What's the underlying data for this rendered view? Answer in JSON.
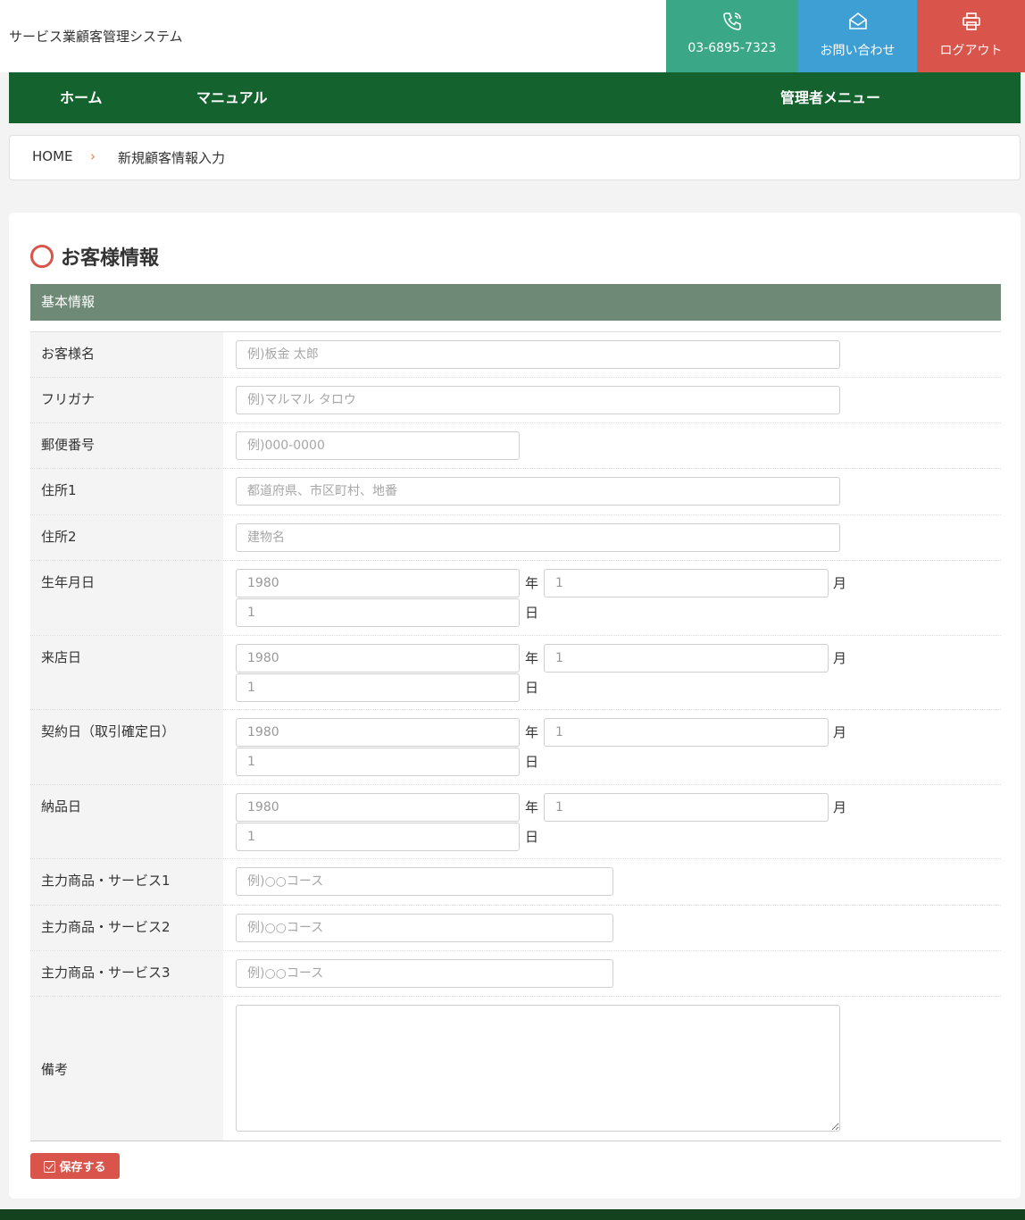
{
  "header": {
    "site_title": "サービス業顧客管理システム",
    "phone_label": "03-6895-7323",
    "contact_label": "お問い合わせ",
    "logout_label": "ログアウト",
    "colors": {
      "phone": "#3aa886",
      "contact": "#3d9fd3",
      "logout": "#d9544a"
    }
  },
  "nav": {
    "home": "ホーム",
    "manual": "マニュアル",
    "admin": "管理者メニュー"
  },
  "breadcrumb": {
    "home": "HOME",
    "separator": "›",
    "current": "新規顧客情報入力"
  },
  "section": {
    "title": "お客様情報",
    "subheading": "基本情報"
  },
  "form": {
    "name": {
      "label": "お客様名",
      "placeholder": "例)板金 太郎"
    },
    "kana": {
      "label": "フリガナ",
      "placeholder": "例)マルマル タロウ"
    },
    "zip": {
      "label": "郵便番号",
      "placeholder": "例)000-0000"
    },
    "address1": {
      "label": "住所1",
      "placeholder": "都道府県、市区町村、地番"
    },
    "address2": {
      "label": "住所2",
      "placeholder": "建物名"
    },
    "units": {
      "year": "年",
      "month": "月",
      "day": "日"
    },
    "birthday": {
      "label": "生年月日",
      "year": "1980",
      "month": "1",
      "day": "1"
    },
    "visit_date": {
      "label": "来店日",
      "year": "1980",
      "month": "1",
      "day": "1"
    },
    "contract_date": {
      "label": "契約日（取引確定日）",
      "year": "1980",
      "month": "1",
      "day": "1"
    },
    "delivery_date": {
      "label": "納品日",
      "year": "1980",
      "month": "1",
      "day": "1"
    },
    "product1": {
      "label": "主力商品・サービス1",
      "placeholder": "例)○○コース"
    },
    "product2": {
      "label": "主力商品・サービス2",
      "placeholder": "例)○○コース"
    },
    "product3": {
      "label": "主力商品・サービス3",
      "placeholder": "例)○○コース"
    },
    "notes": {
      "label": "備考",
      "placeholder": ""
    }
  },
  "actions": {
    "save_label": "保存する"
  }
}
